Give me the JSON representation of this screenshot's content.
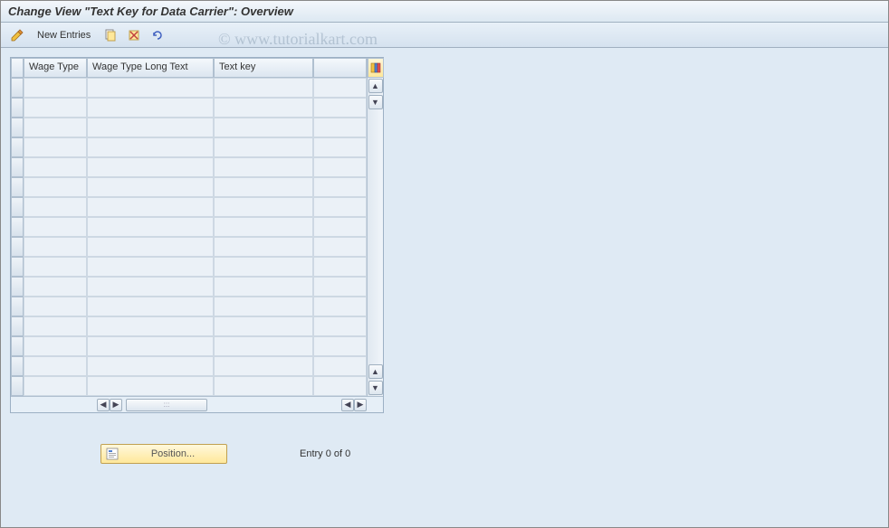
{
  "title": "Change View \"Text Key for Data Carrier\": Overview",
  "toolbar": {
    "new_entries_label": "New Entries"
  },
  "watermark": "© www.tutorialkart.com",
  "table": {
    "columns": {
      "wage_type": "Wage Type",
      "long_text": "Wage Type Long Text",
      "text_key": "Text key"
    },
    "row_count": 16
  },
  "footer": {
    "position_label": "Position...",
    "entry_text": "Entry 0 of 0"
  }
}
